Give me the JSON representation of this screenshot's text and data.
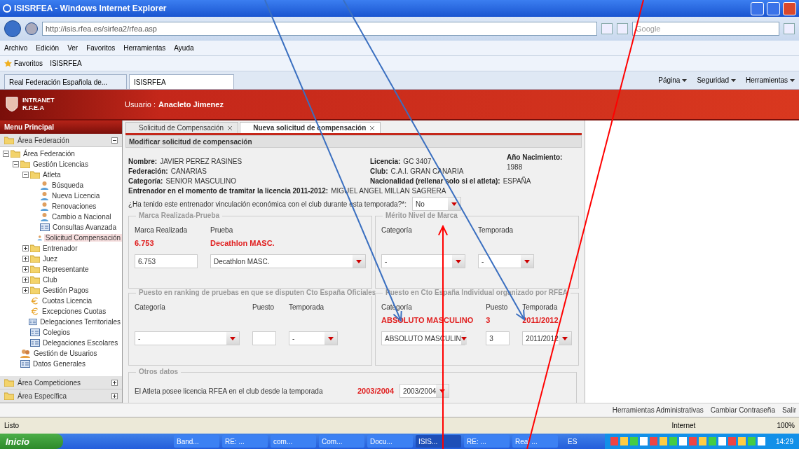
{
  "window": {
    "title": "ISISRFEA - Windows Internet Explorer"
  },
  "address_bar": {
    "url": "http://isis.rfea.es/sirfea2/rfea.asp",
    "search_placeholder": "Google"
  },
  "menu": [
    "Archivo",
    "Edición",
    "Ver",
    "Favoritos",
    "Herramientas",
    "Ayuda"
  ],
  "favorites_bar": {
    "label": "Favoritos",
    "links": [
      "ISISRFEA"
    ]
  },
  "browser_tabs": [
    {
      "label": "Real Federación Española de...",
      "selected": false
    },
    {
      "label": "ISISRFEA",
      "selected": true
    }
  ],
  "command_bar": [
    "Página",
    "Seguridad",
    "Herramientas"
  ],
  "app_header": {
    "logo": [
      "INTRANET",
      "R.F.E.A"
    ],
    "user_label": "Usuario :",
    "user_name": "Anacleto Jimenez"
  },
  "sidebar": {
    "title": "Menu Principal",
    "sections": [
      {
        "label": "Área Federación",
        "expanded": true
      },
      {
        "label": "Área Competiciones",
        "expanded": false
      },
      {
        "label": "Área Específica",
        "expanded": false
      }
    ],
    "tree": [
      {
        "label": "Área Federación",
        "kind": "folder",
        "expanded": true,
        "selected": false,
        "children": [
          {
            "label": "Gestión Licencias",
            "kind": "folder",
            "expanded": true,
            "selected": false,
            "children": [
              {
                "label": "Atleta",
                "kind": "folder",
                "expanded": true,
                "selected": false,
                "children": [
                  {
                    "label": "Búsqueda",
                    "kind": "user",
                    "selected": false
                  },
                  {
                    "label": "Nueva Licencia",
                    "kind": "user",
                    "selected": false
                  },
                  {
                    "label": "Renovaciones",
                    "kind": "user",
                    "selected": false
                  },
                  {
                    "label": "Cambio a Nacional",
                    "kind": "user",
                    "selected": false
                  },
                  {
                    "label": "Consultas Avanzada",
                    "kind": "form",
                    "selected": false
                  },
                  {
                    "label": "Solicitud Compensación",
                    "kind": "user",
                    "selected": true
                  }
                ]
              },
              {
                "label": "Entrenador",
                "kind": "folder",
                "expanded": false,
                "selected": false
              },
              {
                "label": "Juez",
                "kind": "folder",
                "expanded": false,
                "selected": false
              },
              {
                "label": "Representante",
                "kind": "folder",
                "expanded": false,
                "selected": false
              },
              {
                "label": "Club",
                "kind": "folder",
                "expanded": false,
                "selected": false
              },
              {
                "label": "Gestión Pagos",
                "kind": "folder",
                "expanded": false,
                "selected": false
              },
              {
                "label": "Cuotas Licencia",
                "kind": "euro",
                "selected": false
              },
              {
                "label": "Excepciones Cuotas",
                "kind": "euro",
                "selected": false
              },
              {
                "label": "Delegaciones Territoriales",
                "kind": "form",
                "selected": false
              },
              {
                "label": "Colegios",
                "kind": "form",
                "selected": false
              },
              {
                "label": "Delegaciones Escolares",
                "kind": "form",
                "selected": false
              }
            ]
          },
          {
            "label": "Gestión de Usuarios",
            "kind": "users",
            "selected": false
          },
          {
            "label": "Datos Generales",
            "kind": "form",
            "selected": false
          }
        ]
      }
    ]
  },
  "content_tabs": [
    {
      "label": "Solicitud de Compensación",
      "selected": false
    },
    {
      "label": "Nueva solicitud de compensación",
      "selected": true
    }
  ],
  "panel": {
    "title": "Modificar solicitud de compensación",
    "info_left": [
      {
        "label": "Nombre:",
        "value": "JAVIER PEREZ RASINES"
      },
      {
        "label": "Federación:",
        "value": "CANARIAS"
      },
      {
        "label": "Categoría:",
        "value": "SENIOR MASCULINO"
      }
    ],
    "info_middle": [
      {
        "label": "Licencia:",
        "value": "GC 3407"
      },
      {
        "label": "Club:",
        "value": "C.A.I. GRAN CANARIA"
      },
      {
        "label": "Nacionalidad (rellenar solo si el atleta):",
        "value": "ESPAÑA"
      }
    ],
    "info_right": {
      "label": "Año Nacimiento:",
      "value": "1988"
    },
    "coach": {
      "label": "Entrenador en el momento de tramitar la licencia 2011-2012:",
      "value": "MIGUEL ANGEL MILLAN SAGRERA"
    },
    "question": {
      "label": "¿Ha tenido este entrenador vinculación económica con el club durante esta temporada?*:",
      "value": "No"
    },
    "fieldsets": [
      {
        "legend": "Marca Realizada-Prueba",
        "fields": [
          {
            "label": "Marca Realizada",
            "current": "6.753",
            "kind": "input",
            "value": "6.753"
          },
          {
            "label": "Prueba",
            "current": "Decathlon MASC.",
            "kind": "select",
            "value": "Decathlon MASC."
          }
        ]
      },
      {
        "legend": "Mérito Nivel de Marca",
        "fields": [
          {
            "label": "Categoría",
            "kind": "select",
            "value": "-"
          },
          {
            "label": "Temporada",
            "kind": "select",
            "value": "-"
          }
        ]
      },
      {
        "legend": "Puesto en ranking de pruebas en que se disputen Cto España Oficiales",
        "fields": [
          {
            "label": "Categoría",
            "kind": "select",
            "value": "-"
          },
          {
            "label": "Puesto",
            "kind": "input"
          },
          {
            "label": "Temporada",
            "kind": "select",
            "value": "-"
          }
        ]
      },
      {
        "legend": "Puesto en Cto España Individual organizado por RFEA",
        "fields": [
          {
            "label": "Categoría",
            "current": "ABSOLUTO MASCULINO",
            "kind": "select",
            "value": "ABSOLUTO MASCULIN"
          },
          {
            "label": "Puesto",
            "current": "3",
            "kind": "input",
            "value": "3"
          },
          {
            "label": "Temporada",
            "current": "2011/2012",
            "kind": "select",
            "value": "2011/2012"
          }
        ]
      }
    ],
    "other": {
      "legend": "Otros datos",
      "label": "El Atleta posee licencia RFEA en el club desde la temporada",
      "current": "2003/2004",
      "value": "2003/2004"
    }
  },
  "bottom_links": [
    "Herramientas Administrativas",
    "Cambiar Contraseña",
    "Salir"
  ],
  "status_bar": {
    "text": "Listo",
    "zone": "Internet",
    "zoom": "100%"
  },
  "taskbar": {
    "start": "Inicio",
    "items": [
      {
        "label": "Band...",
        "selected": false
      },
      {
        "label": "RE: ...",
        "selected": false
      },
      {
        "label": "com...",
        "selected": false
      },
      {
        "label": "Com...",
        "selected": false
      },
      {
        "label": "Docu...",
        "selected": false
      },
      {
        "label": "ISIS...",
        "selected": true
      },
      {
        "label": "RE: ...",
        "selected": false
      },
      {
        "label": "Real ...",
        "selected": false
      }
    ],
    "language": "ES",
    "clock": "14:29"
  }
}
